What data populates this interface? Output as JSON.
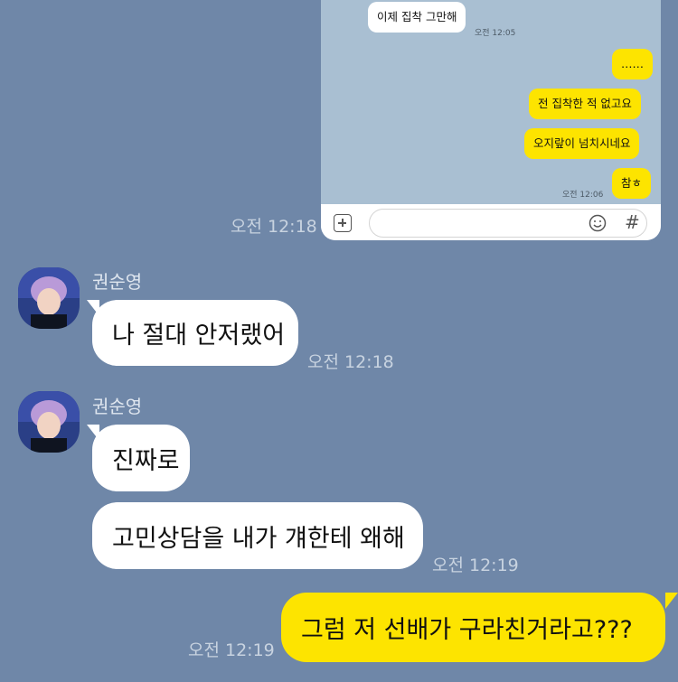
{
  "inner_screen": {
    "messages": [
      {
        "text": "이제 집착 그만해",
        "side": "left"
      },
      {
        "text": "……",
        "side": "right"
      },
      {
        "text": "전 집착한 적 없고요",
        "side": "right"
      },
      {
        "text": "오지랖이 넘치시네요",
        "side": "right"
      },
      {
        "text": "참ㅎ",
        "side": "right"
      }
    ],
    "time_1": "오전 12:05",
    "time_2": "오전 12:06"
  },
  "chat": {
    "time_shared": "오전 12:18",
    "sender_name": "권순영",
    "msg_1": "나 절대 안저랬어",
    "msg_1_time": "오전 12:18",
    "msg_2": "진짜로",
    "msg_3": "고민상담을 내가 걔한테 왜해",
    "msg_3_time": "오전 12:19",
    "my_msg": "그럼 저 선배가 구라친거라고???",
    "my_msg_time": "오전 12:19"
  },
  "colors": {
    "background": "#6f87a8",
    "my_bubble": "#fde400",
    "other_bubble": "#ffffff"
  },
  "icons": [
    "plus-icon",
    "emoji-icon",
    "hash-icon",
    "profile-avatar"
  ]
}
